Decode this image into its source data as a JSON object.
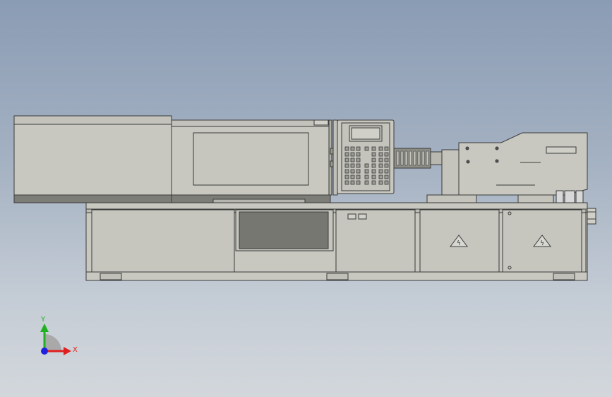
{
  "viewport": {
    "background_top": "#8a9cb4",
    "background_bottom": "#d3d7dc"
  },
  "machine": {
    "body_color": "#c8c8c0",
    "dark_panel_color": "#7a7a74",
    "outline_color": "#3a3a3a",
    "controller_keys_rows": 7,
    "warning_labels": 2
  },
  "triad": {
    "x_label": "X",
    "y_label": "Y",
    "x_color": "#e02020",
    "y_color": "#20b020",
    "z_color": "#2020e0"
  }
}
